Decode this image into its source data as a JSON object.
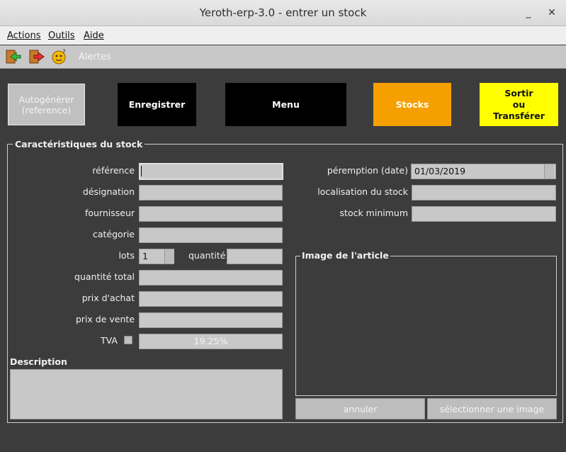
{
  "window": {
    "title": "Yeroth-erp-3.0 - entrer un stock",
    "minimize": "_",
    "close": "✕"
  },
  "menu": [
    "Actions",
    "Outils",
    "Aide"
  ],
  "toolbar": {
    "alerts": "Alertes"
  },
  "buttons": {
    "autogen": "Autogénérer\n(reference)",
    "save": "Enregistrer",
    "menu": "Menu",
    "stocks": "Stocks",
    "exit": "Sortir\nou\nTransférer"
  },
  "group": {
    "title": "Caractéristiques du stock"
  },
  "labels": {
    "reference": "référence",
    "designation": "désignation",
    "supplier": "fournisseur",
    "category": "catégorie",
    "lots": "lots",
    "quantity": "quantité",
    "total_quantity": "quantité total",
    "purchase_price": "prix d'achat",
    "sale_price": "prix de vente",
    "tva": "TVA",
    "description": "Description",
    "expiry": "péremption (date)",
    "location": "localisation du stock",
    "min_stock": "stock minimum",
    "image": "Image de l'article"
  },
  "values": {
    "reference": "",
    "designation": "",
    "supplier": "",
    "category": "",
    "lots": "1",
    "quantity": "",
    "total_quantity": "",
    "purchase_price": "",
    "sale_price": "",
    "tva_rate": "19.25%",
    "tva_checked": false,
    "expiry": "01/03/2019",
    "location": "",
    "min_stock": ""
  },
  "image_buttons": {
    "cancel": "annuler",
    "select": "sélectionner une image"
  },
  "colors": {
    "stocks_btn": "#f5a000",
    "exit_btn": "#ffff00",
    "dark_btn": "#000000",
    "autogen_btn": "#c0c0c0"
  }
}
